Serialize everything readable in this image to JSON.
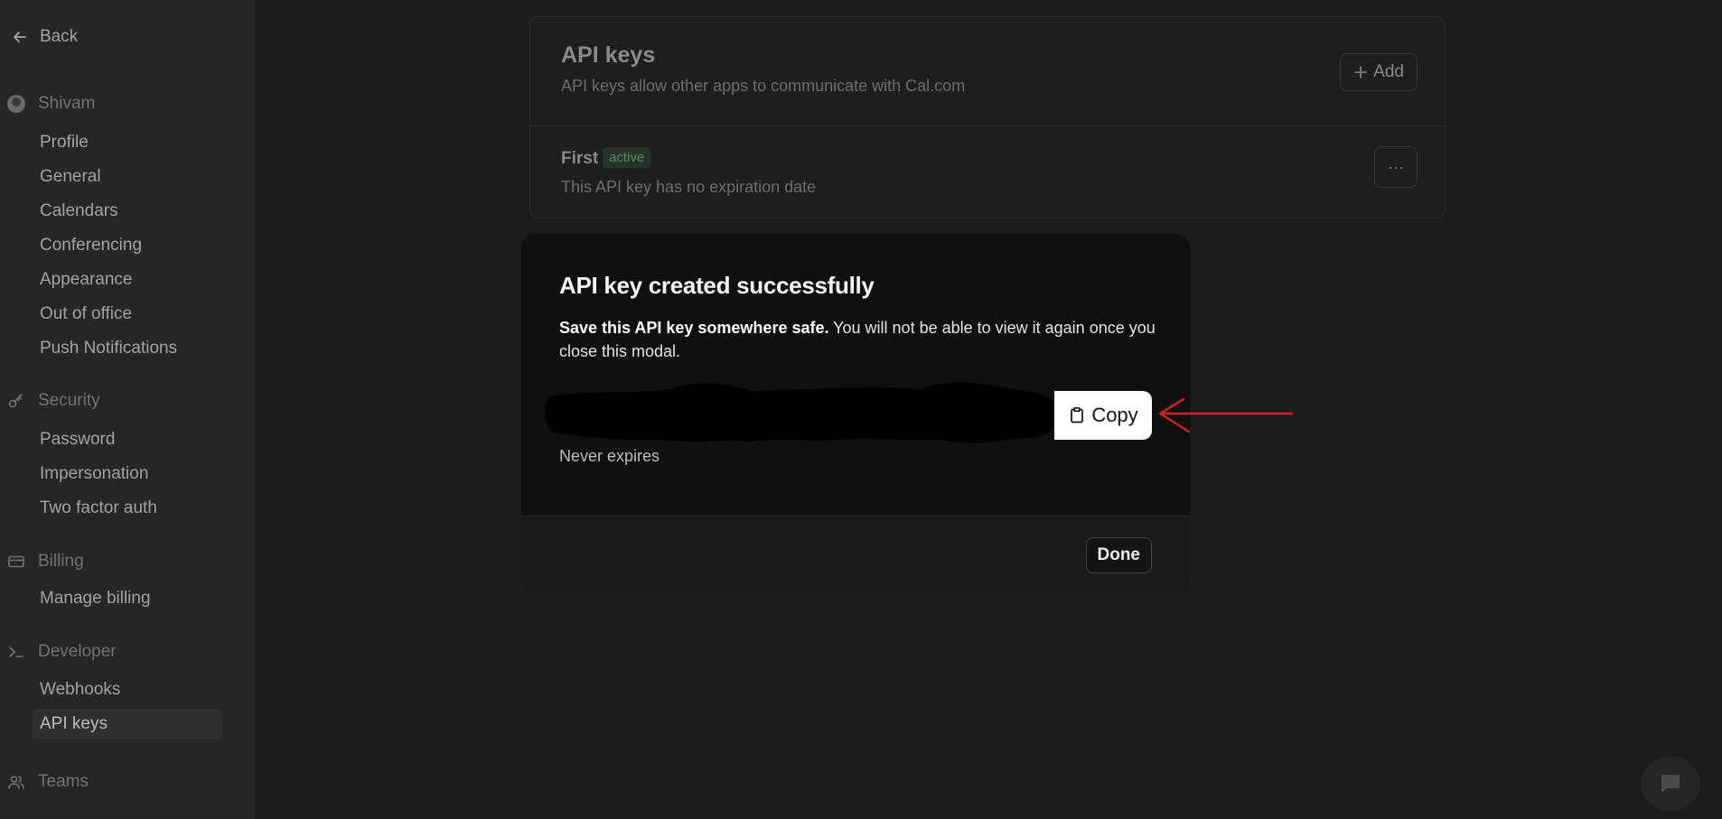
{
  "sidebar": {
    "back_label": "Back",
    "sections": [
      {
        "label": "Shivam",
        "icon": "avatar",
        "items": [
          "Profile",
          "General",
          "Calendars",
          "Conferencing",
          "Appearance",
          "Out of office",
          "Push Notifications"
        ]
      },
      {
        "label": "Security",
        "icon": "key-icon",
        "items": [
          "Password",
          "Impersonation",
          "Two factor auth"
        ]
      },
      {
        "label": "Billing",
        "icon": "credit-card-icon",
        "items": [
          "Manage billing"
        ]
      },
      {
        "label": "Developer",
        "icon": "terminal-icon",
        "items": [
          "Webhooks",
          "API keys"
        ]
      },
      {
        "label": "Teams",
        "icon": "users-icon",
        "items": []
      }
    ],
    "active_item": "API keys"
  },
  "main": {
    "title": "API keys",
    "subtitle": "API keys allow other apps to communicate with Cal.com",
    "add_label": "Add",
    "keys": [
      {
        "name": "First",
        "status": "active",
        "description": "This API key has no expiration date"
      }
    ]
  },
  "modal": {
    "title": "API key created successfully",
    "desc_bold": "Save this API key somewhere safe.",
    "desc_rest": " You will not be able to view it again once you close this modal.",
    "copy_label": "Copy",
    "expires_label": "Never expires",
    "done_label": "Done"
  },
  "colors": {
    "annotation_arrow": "#d42020",
    "badge_text": "#5f8a63",
    "badge_bg": "#24342a"
  }
}
